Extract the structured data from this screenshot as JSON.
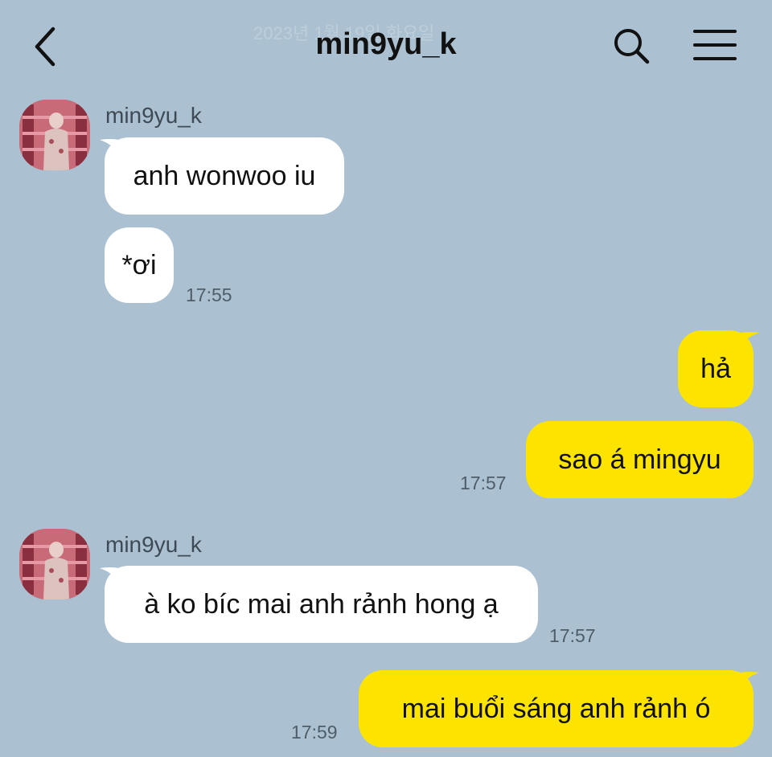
{
  "header": {
    "faded_date": "2023년 1월 19일 화요일",
    "title": "min9yu_k"
  },
  "icons": {
    "back": "chevron-left-icon",
    "search": "search-icon",
    "menu": "hamburger-menu-icon"
  },
  "colors": {
    "background": "#abc1d1",
    "incoming_bubble": "#ffffff",
    "outgoing_bubble": "#fce400"
  },
  "messages": [
    {
      "direction": "in",
      "sender": "min9yu_k",
      "text": "anh wonwoo iu"
    },
    {
      "direction": "in",
      "text": "*ơi",
      "time": "17:55"
    },
    {
      "direction": "out",
      "text": "hả"
    },
    {
      "direction": "out",
      "text": "sao á mingyu",
      "time": "17:57"
    },
    {
      "direction": "in",
      "sender": "min9yu_k",
      "text": "à ko bíc mai anh rảnh hong ạ",
      "time": "17:57"
    },
    {
      "direction": "out",
      "text": "mai buổi sáng anh rảnh ó",
      "time": "17:59"
    }
  ]
}
